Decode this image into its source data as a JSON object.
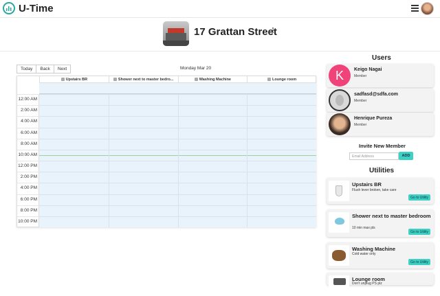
{
  "header": {
    "app_title": "U-Time",
    "logo_icon": "bars-chart-icon",
    "menu_icon": "hamburger-menu-icon"
  },
  "house": {
    "title": "17 Grattan Street"
  },
  "calendar": {
    "toolbar": {
      "today": "Today",
      "back": "Back",
      "next": "Next"
    },
    "date_label": "Monday Mar 20",
    "columns": [
      "Upstairs BR",
      "Shower next to master bedro...",
      "Washing Machine",
      "Lounge room"
    ],
    "times": [
      "12:00 AM",
      "2:00 AM",
      "4:00 AM",
      "6:00 AM",
      "8:00 AM",
      "10:00 AM",
      "12:00 PM",
      "2:00 PM",
      "4:00 PM",
      "6:00 PM",
      "8:00 PM",
      "10:00 PM"
    ]
  },
  "users": {
    "title": "Users",
    "members": [
      {
        "initial": "K",
        "name": "Keigo Nagai",
        "role": "Member"
      },
      {
        "name": "sadfasd@sdfa.com",
        "role": "Member"
      },
      {
        "name": "Henrique Pureza",
        "role": "Member"
      }
    ]
  },
  "invite": {
    "title": "Invite New Member",
    "placeholder": "Email Address",
    "button": "ADD"
  },
  "utilities": {
    "title": "Utilities",
    "items": [
      {
        "name": "Upstairs BR",
        "description": "Flush lever broken, take care",
        "button": "Go to Utility"
      },
      {
        "name": "Shower next to master bedroom",
        "description": "10 min max pls",
        "button": "Go to Utility"
      },
      {
        "name": "Washing Machine",
        "description": "Cold water only",
        "button": "Go to Utility"
      },
      {
        "name": "Lounge room",
        "description": "Don't unplug PS plz"
      }
    ]
  },
  "colors": {
    "accent": "#3ed1c3",
    "calendar_bg": "#e8f3fc",
    "avatar_pink": "#f0437a"
  }
}
